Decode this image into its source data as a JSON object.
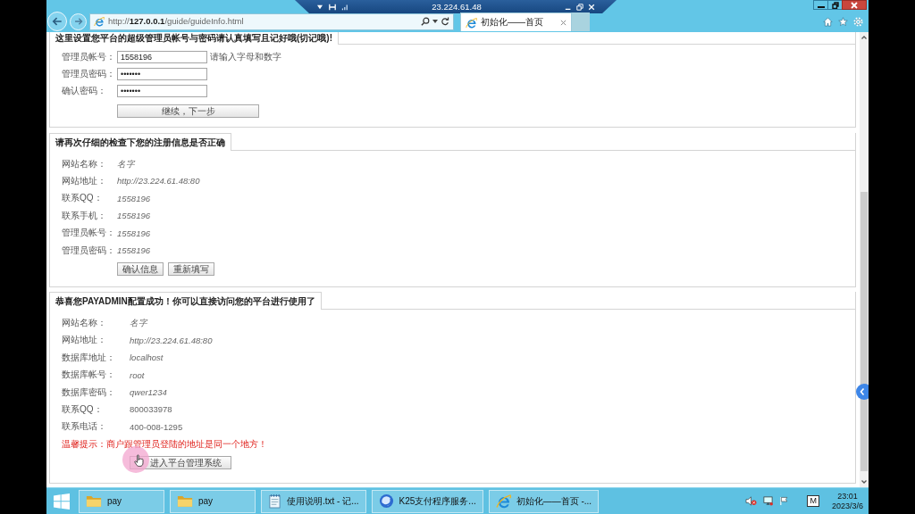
{
  "remote_bar": {
    "title": "23.224.61.48"
  },
  "browser": {
    "address": "http://**127.0.0.1**/guide/guideInfo.html",
    "tabs": [
      {
        "label": "初始化——首页",
        "selected": true
      }
    ]
  },
  "panels": [
    {
      "kind": "form",
      "heading": "这里设置您平台的超级管理员帐号与密码请认真填写且记好哦(切记哦)!",
      "fields": [
        {
          "label": "管理员帐号：",
          "value": "1558196",
          "hint": "请输入字母和数字"
        },
        {
          "label": "管理员密码：",
          "value": "•••••••"
        },
        {
          "label": "确认密码：",
          "value": "•••••••"
        }
      ],
      "buttons": [
        "继续，下一步"
      ]
    },
    {
      "kind": "summary",
      "heading": "请再次仔细的检查下您的注册信息是否正确",
      "rows": [
        {
          "label": "网站名称：",
          "value": "名字",
          "italic": true
        },
        {
          "label": "网站地址：",
          "value": "http://23.224.61.48:80",
          "italic": true
        },
        {
          "label": "联系QQ：",
          "value": "1558196",
          "italic": true
        },
        {
          "label": "联系手机：",
          "value": "1558196",
          "italic": true
        },
        {
          "label": "管理员帐号：",
          "value": "1558196",
          "italic": true
        },
        {
          "label": "管理员密码：",
          "value": "1558196",
          "italic": true
        }
      ],
      "buttons": [
        "确认信息",
        "重新填写"
      ]
    },
    {
      "kind": "summary",
      "heading": "恭喜您PAYADMIN配置成功！你可以直接访问您的平台进行使用了",
      "rows": [
        {
          "label": "网站名称：",
          "value": "名字",
          "italic": true
        },
        {
          "label": "网站地址：",
          "value": "http://23.224.61.48:80",
          "italic": true
        },
        {
          "label": "数据库地址：",
          "value": "localhost",
          "italic": true
        },
        {
          "label": "数据库帐号：",
          "value": "root",
          "italic": true
        },
        {
          "label": "数据库密码：",
          "value": "qwer1234",
          "italic": true
        },
        {
          "label": "联系QQ：",
          "value": "800033978",
          "italic": false
        },
        {
          "label": "联系电话：",
          "value": "400-008-1295",
          "italic": false
        }
      ],
      "notice": "温馨提示：商户跟管理员登陆的地址是同一个地方！",
      "buttons": [
        "进入平台管理系统"
      ]
    }
  ],
  "taskbar": {
    "items": [
      {
        "kind": "folder",
        "label": "pay"
      },
      {
        "kind": "folder",
        "label": "pay"
      },
      {
        "kind": "notepad",
        "label": "使用说明.txt - 记..."
      },
      {
        "kind": "app",
        "label": "K25支付程序服务..."
      },
      {
        "kind": "browser",
        "label": "初始化——首页 -..."
      }
    ],
    "ime": "M",
    "time": "23:01",
    "date": "2023/3/6"
  }
}
